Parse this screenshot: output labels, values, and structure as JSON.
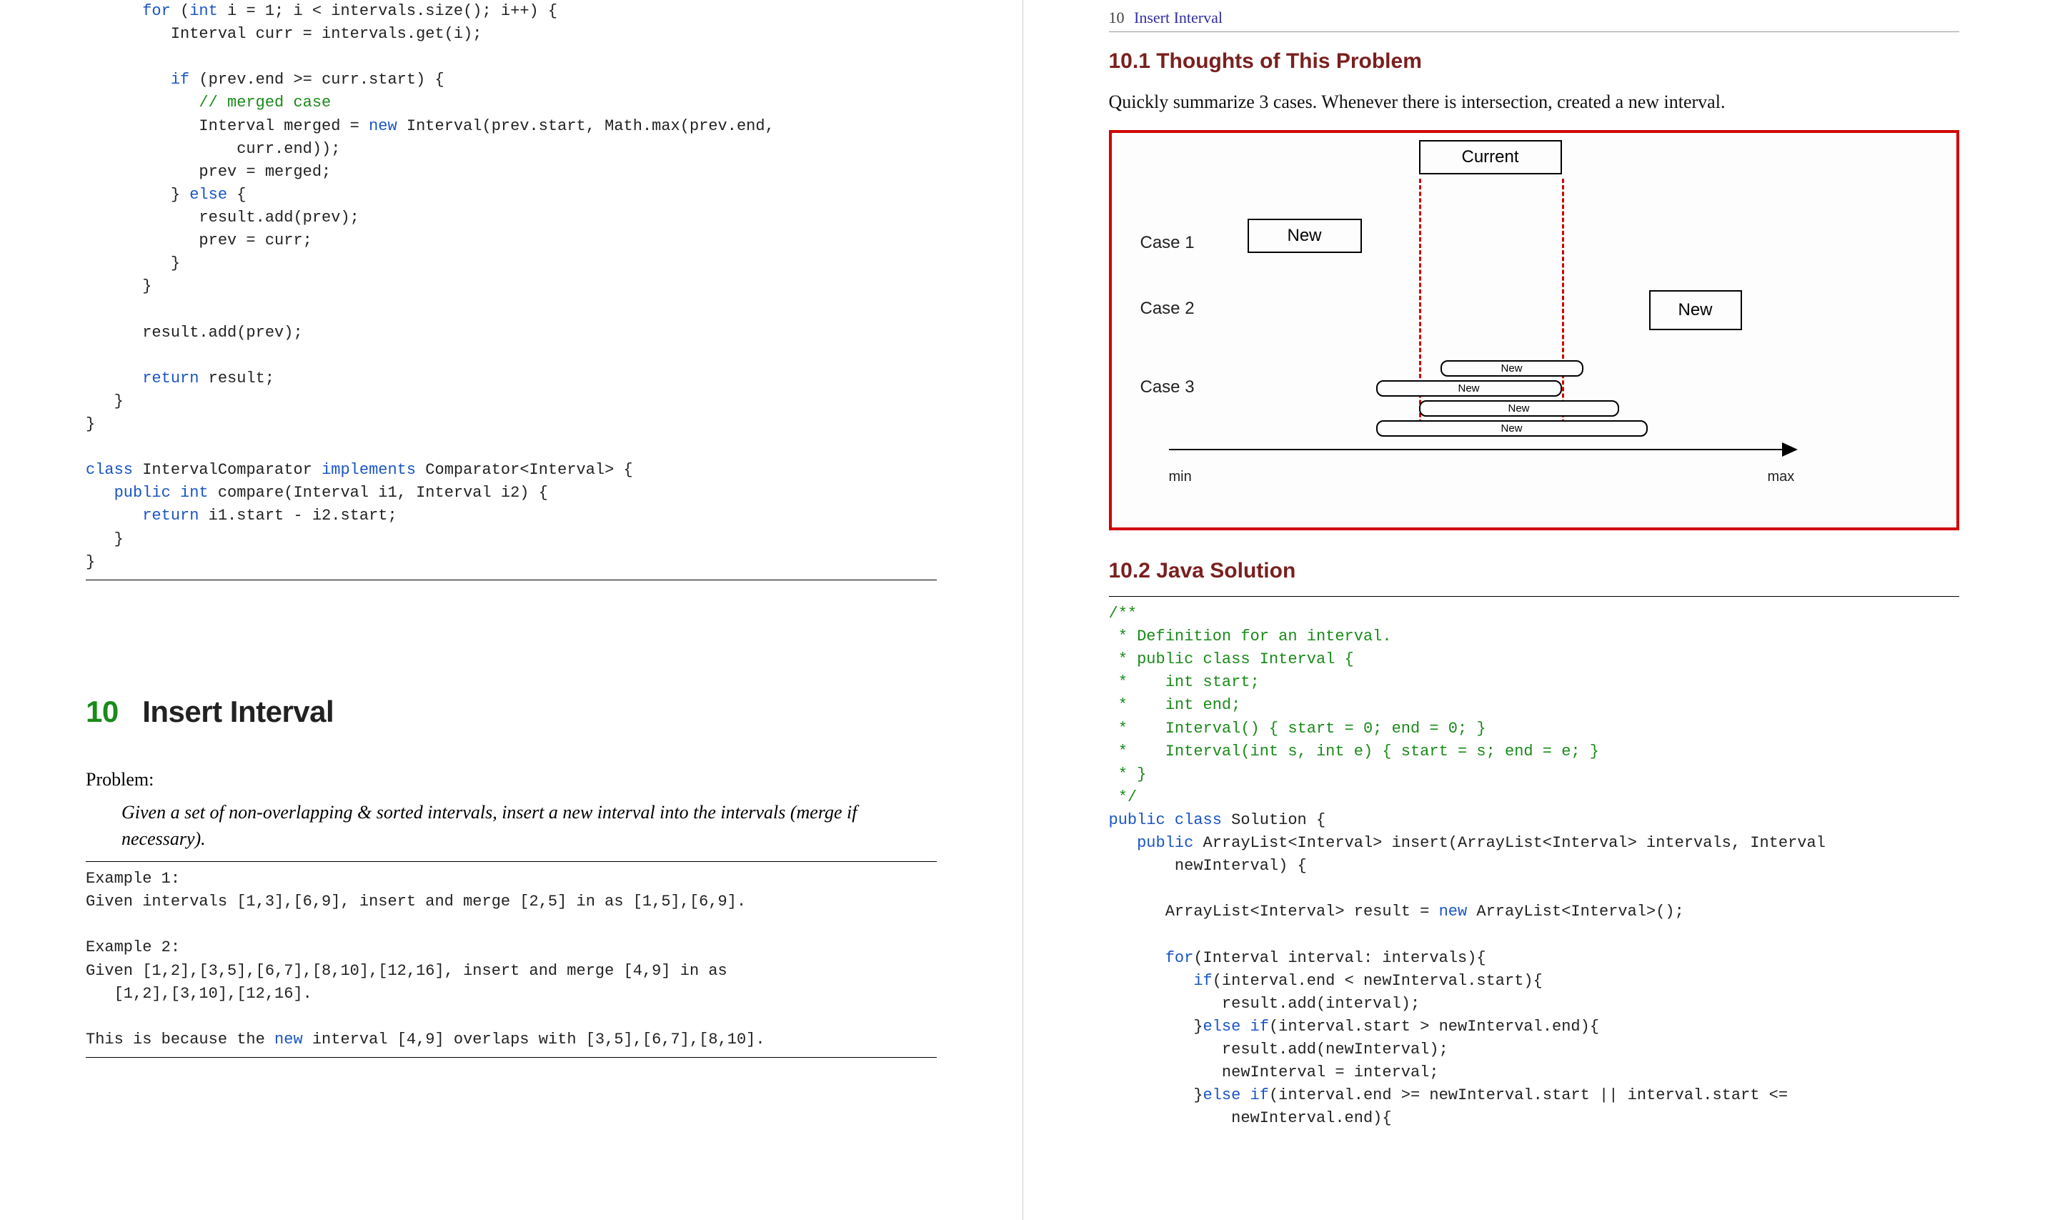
{
  "left": {
    "code1": {
      "l1a": "for",
      "l1b": " (",
      "l1c": "int",
      "l1d": " i = 1; i < intervals.size(); i++) {",
      "l2": "         Interval curr = intervals.get(i);",
      "l4a": "if",
      "l4b": " (prev.end >= curr.start) {",
      "l5": "            // merged case",
      "l6a": "            Interval merged = ",
      "l6b": "new",
      "l6c": " Interval(prev.start, Math.max(prev.end,",
      "l7": "                curr.end));",
      "l8": "            prev = merged;",
      "l9a": "         } ",
      "l9b": "else",
      "l9c": " {",
      "l10": "            result.add(prev);",
      "l11": "            prev = curr;",
      "l12": "         }",
      "l13": "      }",
      "l15": "      result.add(prev);",
      "l17a": "return",
      "l17b": " result;",
      "l18": "   }",
      "l19": "}",
      "l21a": "class",
      "l21b": " IntervalComparator ",
      "l21c": "implements",
      "l21d": " Comparator<Interval> {",
      "l22a": "public",
      "l22b": " ",
      "l22c": "int",
      "l22d": " compare(Interval i1, Interval i2) {",
      "l23a": "return",
      "l23b": " i1.start - i2.start;",
      "l24": "   }",
      "l25": "}"
    },
    "section_num": "10",
    "section_title": "Insert Interval",
    "problem_label": "Problem:",
    "problem_statement": "Given a set of non-overlapping & sorted intervals, insert a new interval into the intervals (merge if necessary).",
    "examples": {
      "e1a": "Example 1:",
      "e1b": "Given intervals [1,3],[6,9], insert and merge [2,5] in as [1,5],[6,9].",
      "e2a": "Example 2:",
      "e2b": "Given [1,2],[3,5],[6,7],[8,10],[12,16], insert and merge [4,9] in as",
      "e2c": "   [1,2],[3,10],[12,16].",
      "e3a": "This is because the ",
      "e3b": "new",
      "e3c": " interval [4,9] overlaps with [3,5],[6,7],[8,10]."
    }
  },
  "right": {
    "header_num": "10",
    "header_title": "Insert Interval",
    "sub1": "10.1  Thoughts of This Problem",
    "body1": "Quickly summarize 3 cases. Whenever there is intersection, created a new interval.",
    "diagram": {
      "current": "Current",
      "case1": "Case 1",
      "case2": "Case 2",
      "case3": "Case 3",
      "new": "New",
      "min": "min",
      "max": "max"
    },
    "sub2": "10.2  Java Solution",
    "code2": {
      "c1": "/**",
      "c2": " * Definition for an interval.",
      "c3": " * public class Interval {",
      "c4": " *    int start;",
      "c5": " *    int end;",
      "c6": " *    Interval() { start = 0; end = 0; }",
      "c7": " *    Interval(int s, int e) { start = s; end = e; }",
      "c8": " * }",
      "c9": " */",
      "l1a": "public",
      "l1b": " ",
      "l1c": "class",
      "l1d": " Solution {",
      "l2a": "public",
      "l2b": " ArrayList<Interval> insert(ArrayList<Interval> intervals, Interval",
      "l3": "       newInterval) {",
      "l5a": "      ArrayList<Interval> result = ",
      "l5b": "new",
      "l5c": " ArrayList<Interval>();",
      "l7a": "for",
      "l7b": "(Interval interval: intervals){",
      "l8a": "if",
      "l8b": "(interval.end < newInterval.start){",
      "l9": "            result.add(interval);",
      "l10a": "         }",
      "l10b": "else",
      "l10c": " ",
      "l10d": "if",
      "l10e": "(interval.start > newInterval.end){",
      "l11": "            result.add(newInterval);",
      "l12": "            newInterval = interval;",
      "l13a": "         }",
      "l13b": "else",
      "l13c": " ",
      "l13d": "if",
      "l13e": "(interval.end >= newInterval.start || interval.start <=",
      "l14": "             newInterval.end){"
    }
  }
}
